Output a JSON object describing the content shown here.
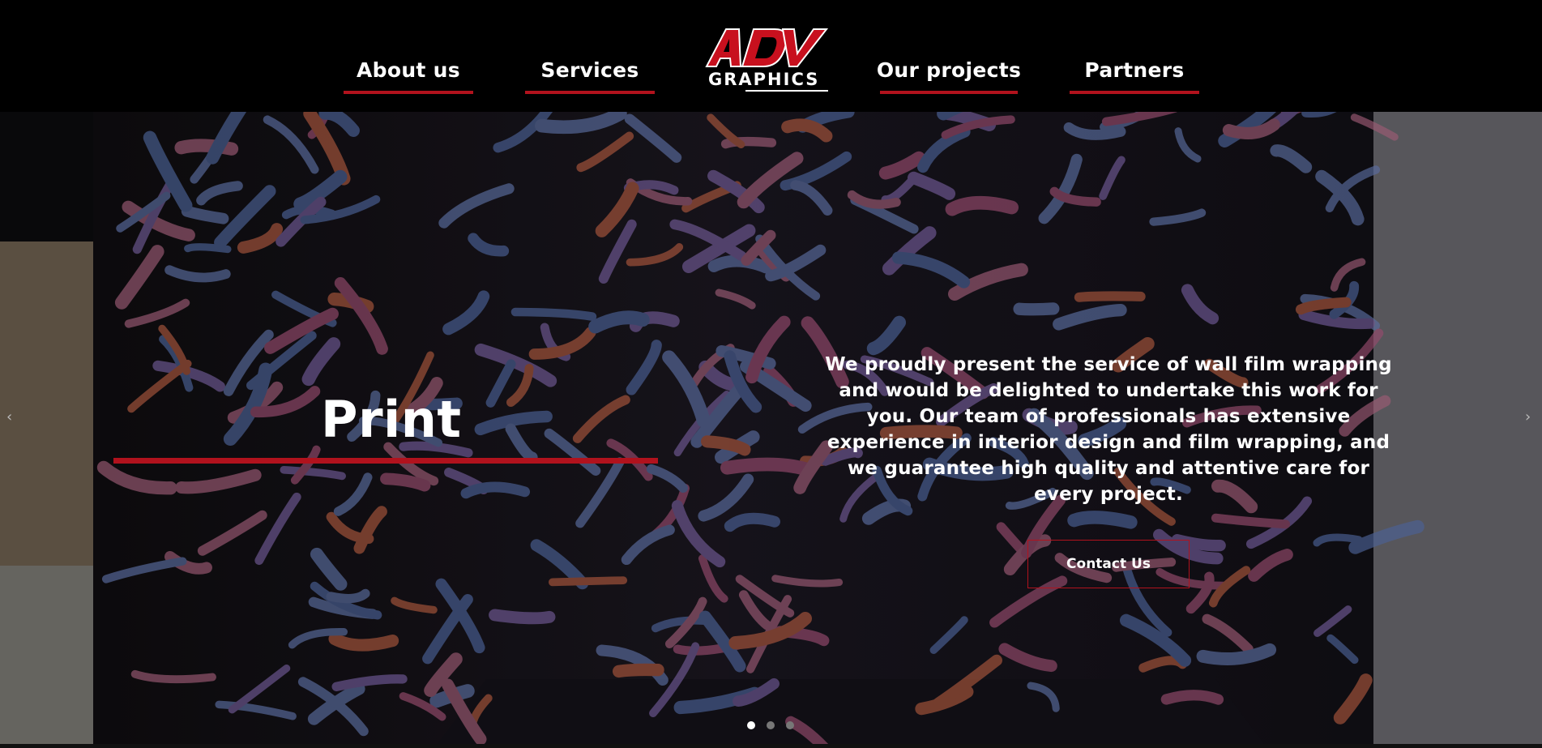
{
  "nav": {
    "items": [
      {
        "label": "About us"
      },
      {
        "label": "Services"
      },
      {
        "label": "Our projects"
      },
      {
        "label": "Partners"
      }
    ]
  },
  "logo": {
    "mark": "ADV",
    "word": "GRAPHICS"
  },
  "hero": {
    "title": "Print",
    "description": "We proudly present the service of wall film wrapping and would be delighted to undertake this work for you. Our team of professionals has extensive experience in interior design and film wrapping, and we guarantee high quality and attentive care for every project.",
    "cta_label": "Contact Us",
    "prev_arrow": "‹",
    "next_arrow": "›",
    "slide_count": 3,
    "active_slide": 1
  },
  "colors": {
    "accent": "#b1121d",
    "background": "#000000",
    "text": "#ffffff"
  },
  "icons": {
    "prev": "chevron-left-icon",
    "next": "chevron-right-icon"
  }
}
